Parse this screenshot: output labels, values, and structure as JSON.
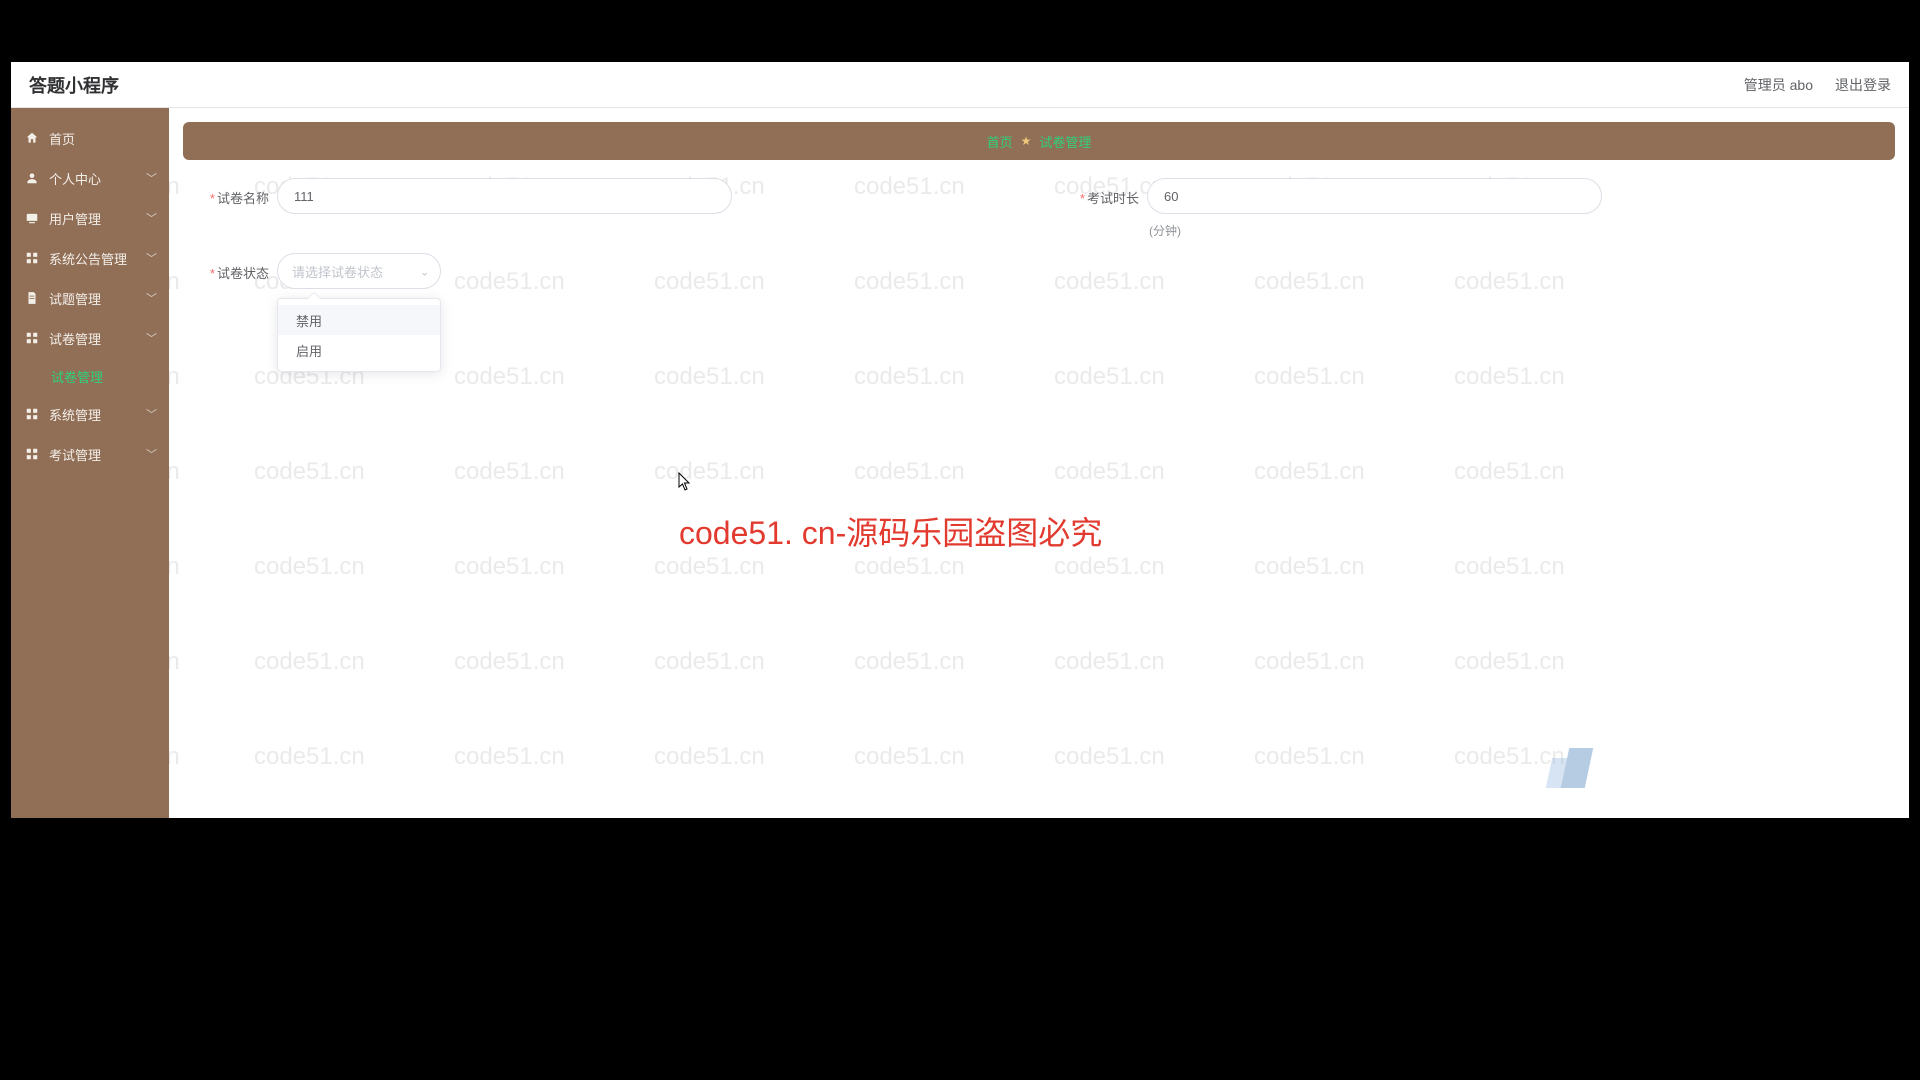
{
  "app": {
    "title": "答题小程序"
  },
  "topbar": {
    "user_label": "管理员 abo",
    "logout_label": "退出登录"
  },
  "sidebar": {
    "items": [
      {
        "label": "首页",
        "icon": "home-icon",
        "has_chev": false
      },
      {
        "label": "个人中心",
        "icon": "user-icon",
        "has_chev": true
      },
      {
        "label": "用户管理",
        "icon": "users-icon",
        "has_chev": true
      },
      {
        "label": "系统公告管理",
        "icon": "grid-icon",
        "has_chev": true
      },
      {
        "label": "试题管理",
        "icon": "doc-icon",
        "has_chev": true
      },
      {
        "label": "试卷管理",
        "icon": "grid-icon",
        "has_chev": true
      },
      {
        "label": "系统管理",
        "icon": "grid-icon",
        "has_chev": true
      },
      {
        "label": "考试管理",
        "icon": "grid-icon",
        "has_chev": true
      }
    ],
    "sub_active": "试卷管理"
  },
  "breadcrumb": {
    "home": "首页",
    "sep": "★",
    "current": "试卷管理"
  },
  "form": {
    "name_label": "试卷名称",
    "name_value": "111",
    "duration_label": "考试时长",
    "duration_value": "60",
    "duration_unit": "(分钟)",
    "status_label": "试卷状态",
    "status_placeholder": "请选择试卷状态",
    "status_options": [
      "禁用",
      "启用"
    ]
  },
  "watermark": {
    "text": "code51.cn",
    "banner": "code51. cn-源码乐园盗图必究"
  }
}
